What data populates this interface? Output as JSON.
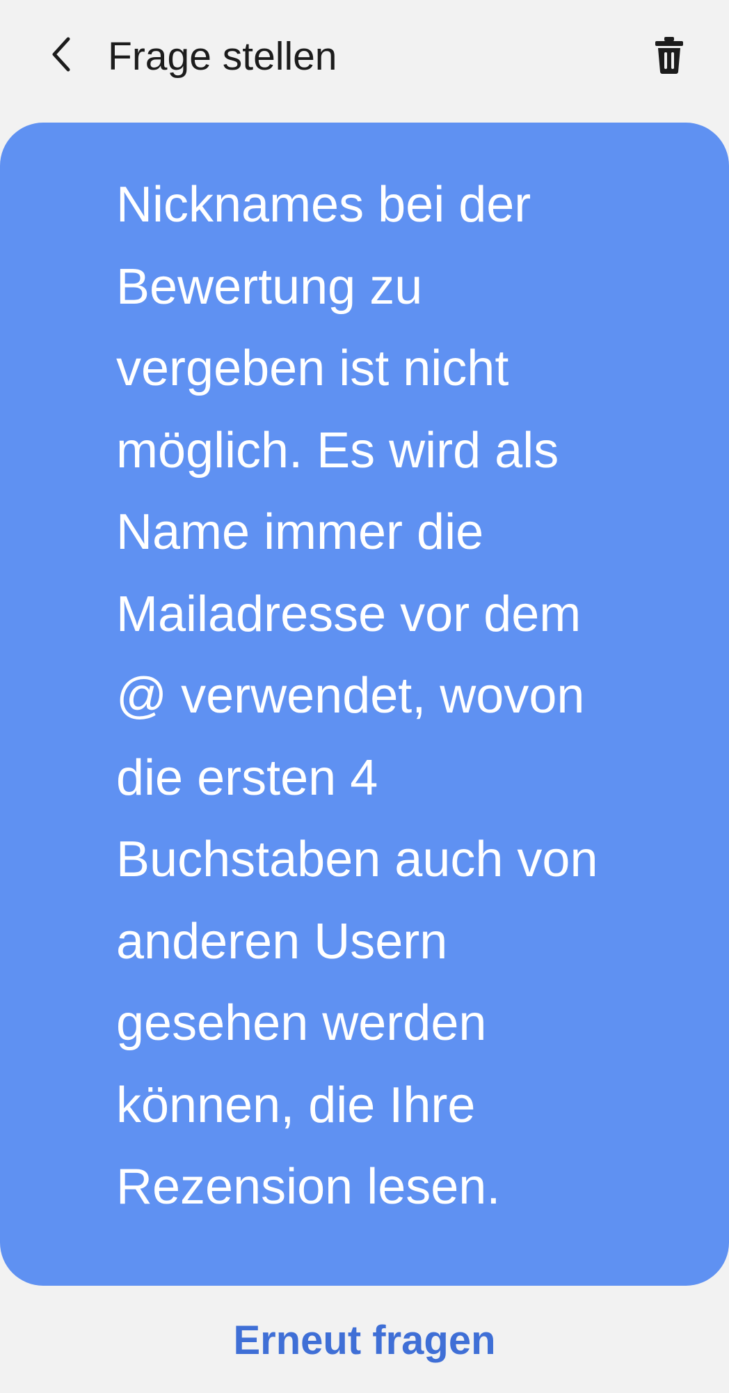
{
  "header": {
    "title": "Frage stellen",
    "back_icon": "chevron-left-icon",
    "delete_icon": "trash-icon"
  },
  "message": {
    "text": "Nicknames bei der\nBewertung zu\nvergeben ist nicht\nmöglich. Es wird als\nName immer die\nMailadresse vor dem\n@ verwendet, wovon\ndie ersten 4\nBuchstaben auch von\nanderen Usern\ngesehen werden\nkönnen, die Ihre\nRezension lesen."
  },
  "footer": {
    "action_label": "Erneut fragen"
  },
  "colors": {
    "background": "#f2f2f2",
    "bubble": "#5f91f2",
    "accent": "#3f6fd6"
  }
}
